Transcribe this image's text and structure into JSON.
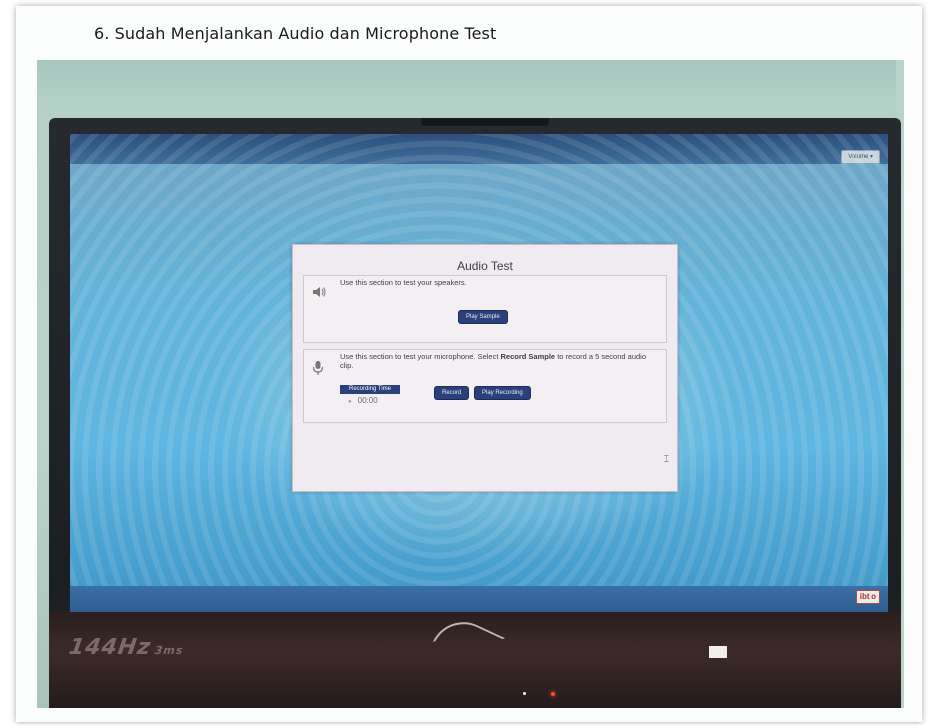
{
  "document": {
    "heading": "6.   Sudah Menjalankan Audio dan Microphone Test"
  },
  "screen": {
    "volume_button": "Volume ▾",
    "logo_text": "ibt o",
    "audio_test": {
      "title": "Audio Test",
      "speakers_section": {
        "icon": "speaker-icon",
        "text": "Use this section to test your speakers.",
        "play_sample_label": "Play Sample"
      },
      "mic_section": {
        "icon": "microphone-icon",
        "text_before": "Use this section to test your microphone. Select ",
        "text_bold": "Record Sample",
        "text_after": " to record a 5 second audio clip.",
        "recording_time_label": "Recording Time",
        "recording_time_value": "00:00",
        "record_label": "Record",
        "play_recording_label": "Play Recording"
      }
    }
  },
  "laptop": {
    "brand_label": "144Hz",
    "brand_sub": "3ms"
  },
  "colors": {
    "dialog_button": "#2b3f7a",
    "screen_blue": "#5fb6e0",
    "led_red": "#ff4a2a"
  }
}
